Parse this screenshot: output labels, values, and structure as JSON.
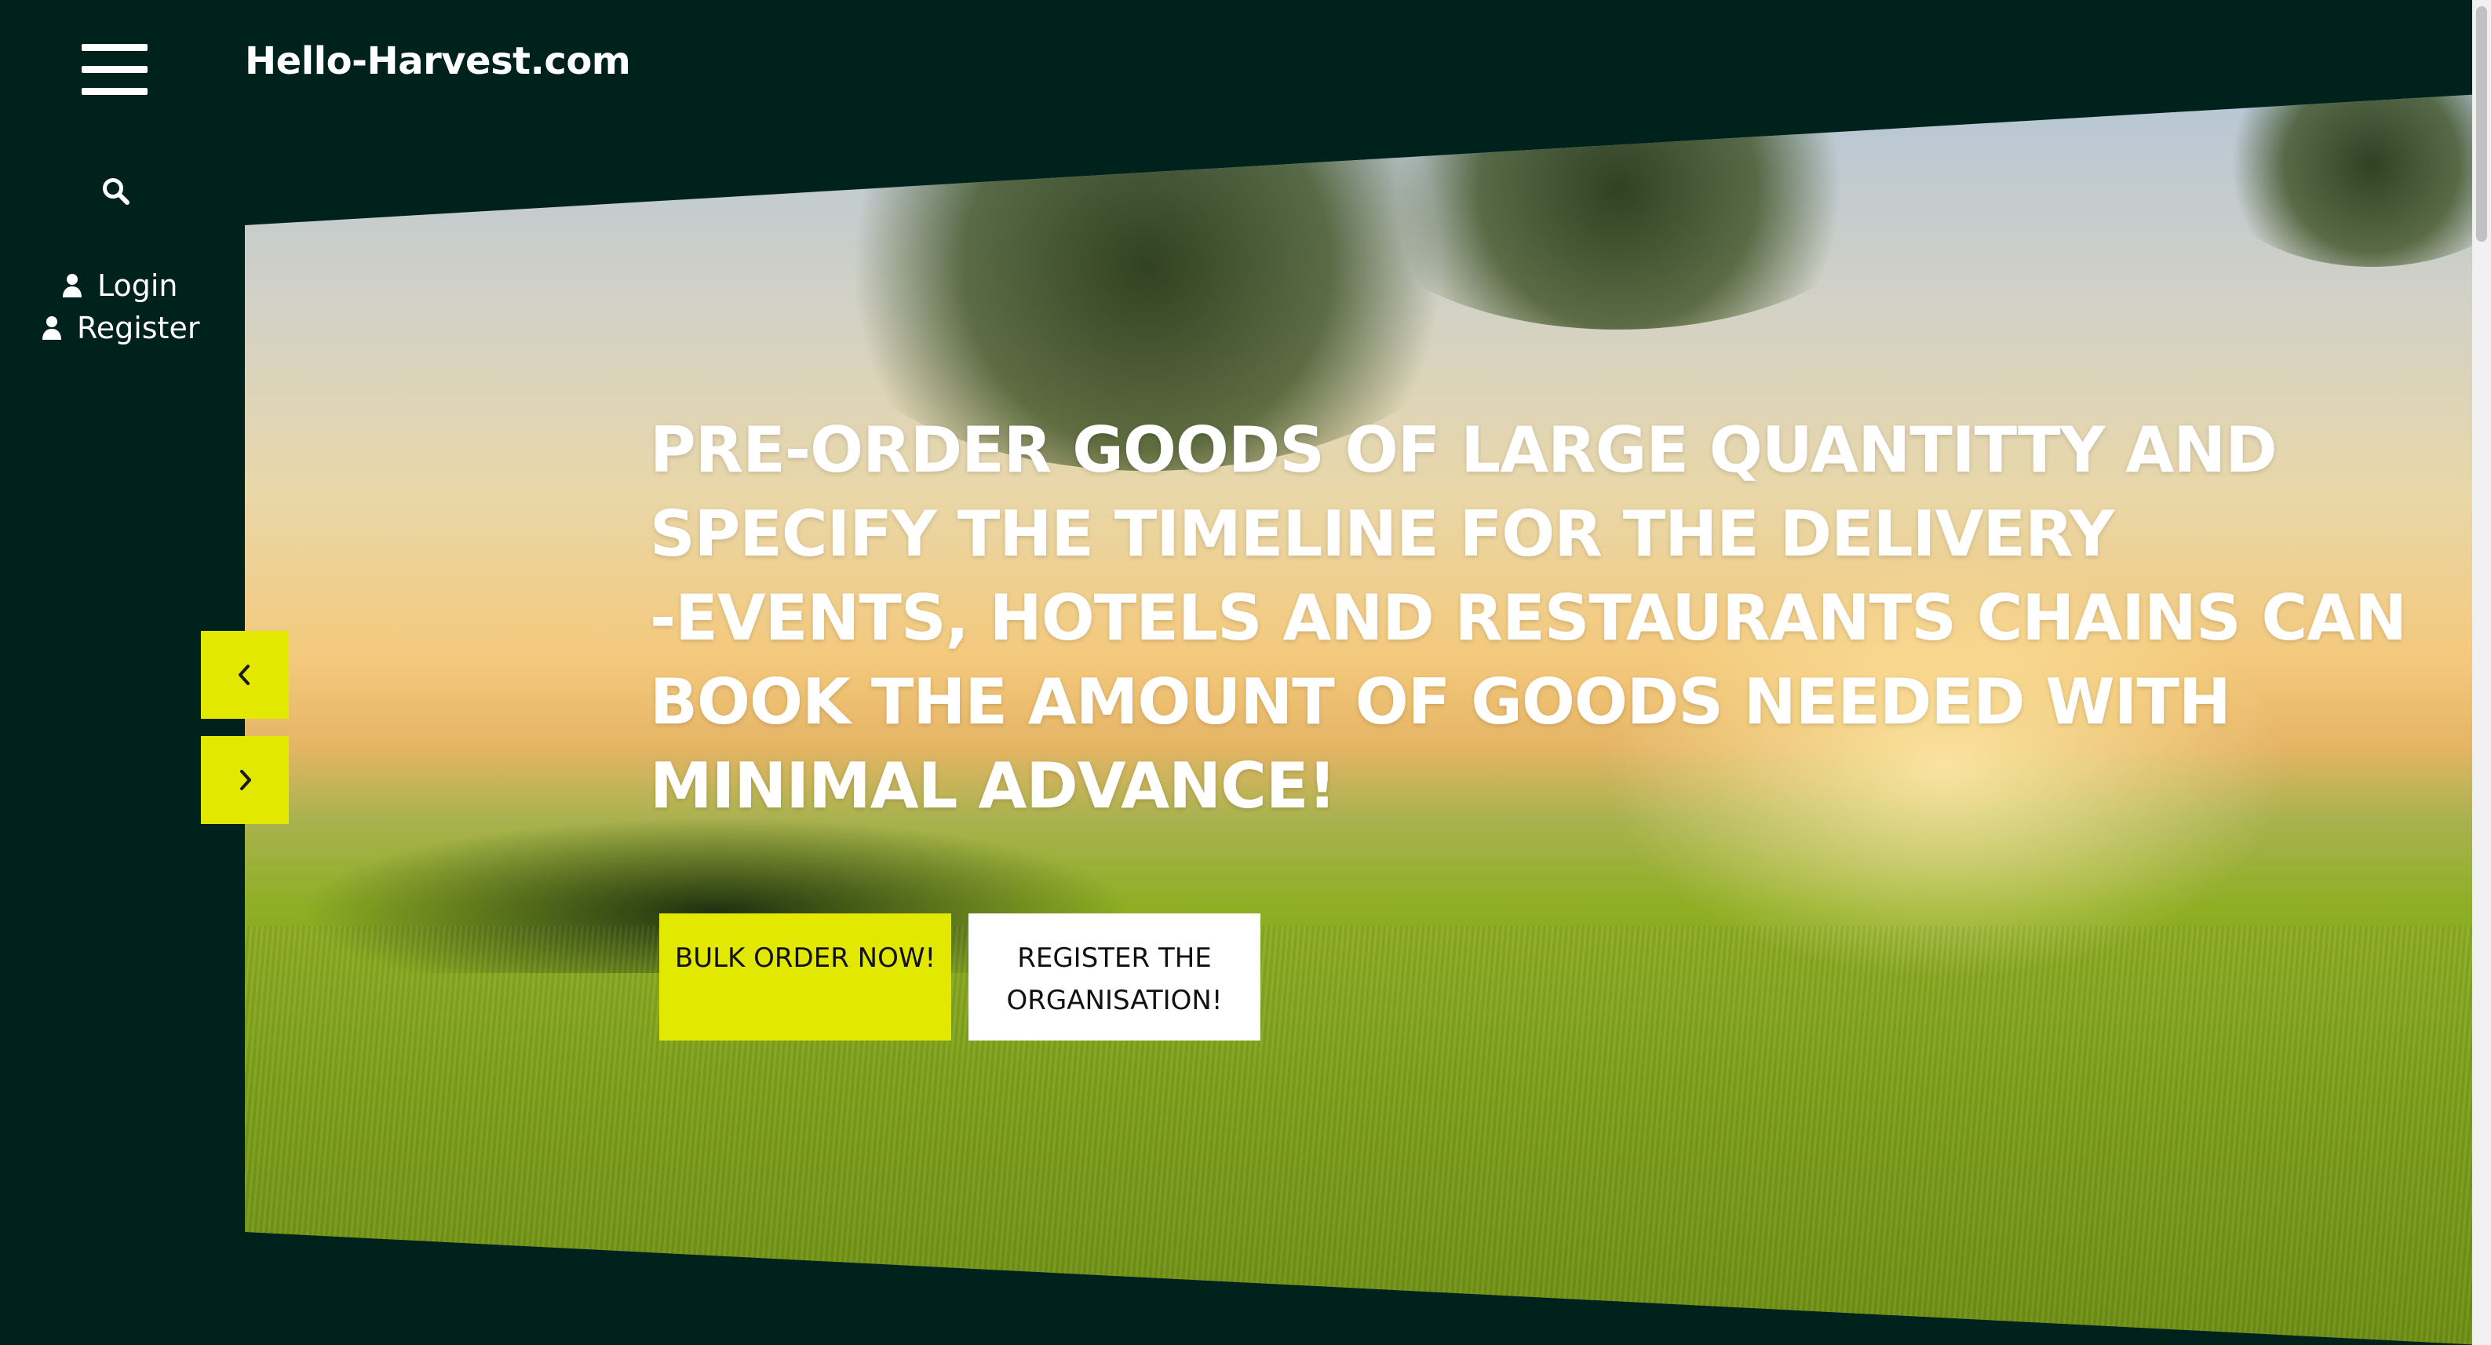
{
  "header": {
    "brand": "Hello-Harvest.com",
    "menu_icon": "hamburger-menu-icon"
  },
  "sidebar": {
    "search_icon": "search-icon",
    "login_label": "Login",
    "register_label": "Register",
    "user_icon": "user-icon"
  },
  "hero": {
    "headline_lines": [
      "PRE-ORDER GOODS OF LARGE QUANTITTY AND",
      "SPECIFY THE TIMELINE FOR THE DELIVERY",
      "-EVENTS, HOTELS AND RESTAURANTS CHAINS CAN",
      "BOOK THE AMOUNT OF GOODS NEEDED WITH",
      "MINIMAL ADVANCE!"
    ],
    "primary_button": "BULK ORDER NOW!",
    "secondary_button": "REGISTER THE ORGANISATION!",
    "prev_icon": "chevron-left-icon",
    "next_icon": "chevron-right-icon"
  },
  "colors": {
    "background": "#00221d",
    "accent": "#e3e800",
    "text": "#ffffff"
  }
}
